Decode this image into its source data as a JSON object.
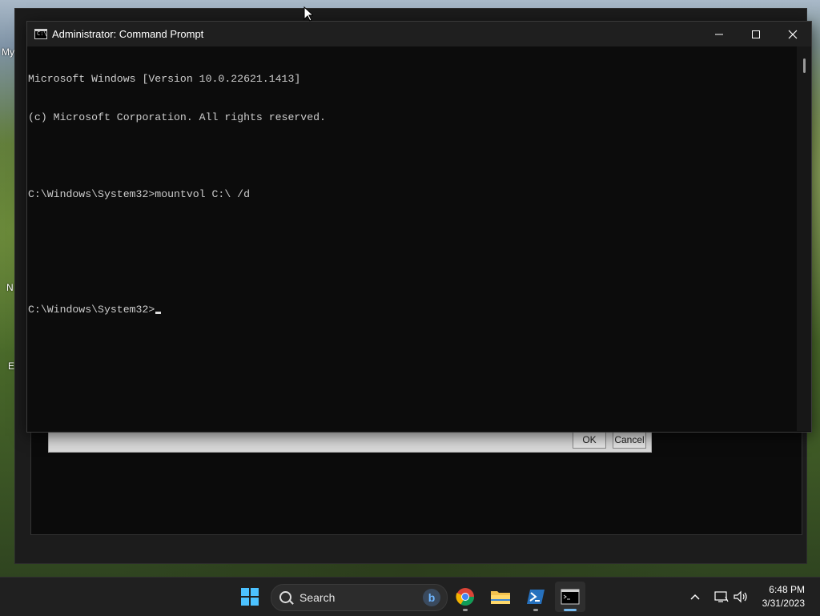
{
  "desktop": {
    "labels": [
      "My",
      "N",
      "E"
    ]
  },
  "background_dialog": {
    "ok_label": "OK",
    "cancel_label": "Cancel"
  },
  "cmd_window": {
    "title": "Administrator: Command Prompt",
    "icon_text": "C:\\",
    "lines": [
      "Microsoft Windows [Version 10.0.22621.1413]",
      "(c) Microsoft Corporation. All rights reserved.",
      "",
      "C:\\Windows\\System32>mountvol C:\\ /d",
      "",
      "",
      "C:\\Windows\\System32>"
    ],
    "minimize_icon": "minimize-icon",
    "maximize_icon": "maximize-icon",
    "close_icon": "close-icon"
  },
  "taskbar": {
    "search_placeholder": "Search",
    "apps": [
      "windows-start",
      "chrome",
      "file-explorer",
      "powershell",
      "command-prompt"
    ],
    "active_app": "command-prompt",
    "clock_time": "6:48 PM",
    "clock_date": "3/31/2023"
  },
  "colors": {
    "terminal_bg": "#0c0c0c",
    "terminal_fg": "#cccccc",
    "titlebar_bg": "#1f1f1f",
    "taskbar_bg": "#202020",
    "accent": "#76b9ed"
  }
}
